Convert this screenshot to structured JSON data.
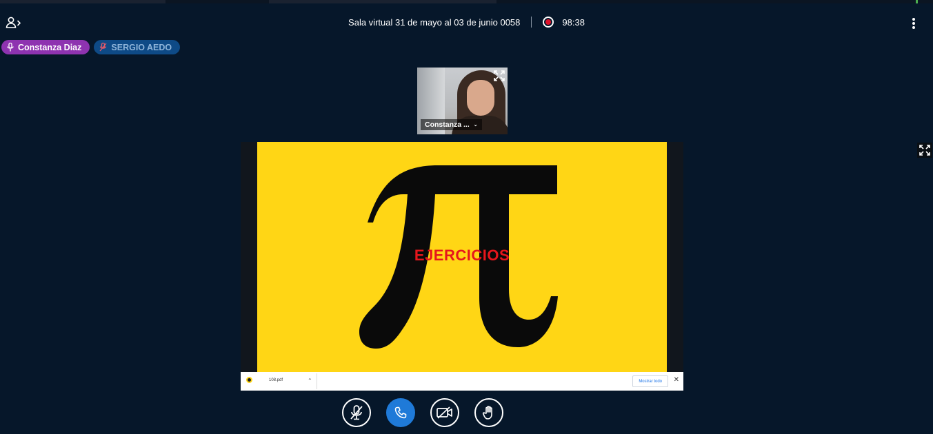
{
  "header": {
    "room_title": "Sala virtual 31 de mayo al 03 de junio 0058",
    "recording_time": "98:38",
    "recording_color": "#e0122a"
  },
  "talkers": [
    {
      "name": "Constanza Diaz",
      "state": "talking",
      "icon": "microphone-icon",
      "color": "#8e33b0"
    },
    {
      "name": "SERGIO AEDO",
      "state": "muted",
      "icon": "microphone-muted-icon",
      "color": "#0e4a86"
    }
  ],
  "webcam": {
    "user_label": "Constanza ...",
    "expand_icon": "fullscreen-icon"
  },
  "presentation": {
    "slide_symbol": "π",
    "slide_label": "EJERCICIOS",
    "slide_background": "#ffd615",
    "label_color": "#e6161c",
    "download_bar": {
      "file_name": "108.pdf",
      "show_all_label": "Mostrar todo",
      "close_label": "✕"
    },
    "expand_icon": "fullscreen-icon"
  },
  "controls": [
    {
      "name": "mute-microphone",
      "icon": "microphone-muted-icon"
    },
    {
      "name": "leave-audio",
      "icon": "phone-icon"
    },
    {
      "name": "share-webcam",
      "icon": "camera-off-icon"
    },
    {
      "name": "raise-hand",
      "icon": "hand-icon"
    }
  ],
  "accent_color": "#1f7ad8"
}
